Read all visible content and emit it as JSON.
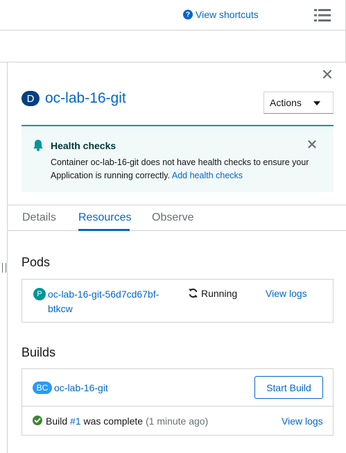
{
  "toolbar": {
    "shortcuts_label": "View shortcuts"
  },
  "drawer": {
    "resource_kind_badge": "D",
    "resource_name": "oc-lab-16-git",
    "actions_label": "Actions"
  },
  "alert": {
    "title": "Health checks",
    "message": "Container oc-lab-16-git does not have health checks to ensure your Application is running correctly.",
    "link": "Add health checks",
    "accent_color": "#009596"
  },
  "tabs": [
    {
      "label": "Details",
      "active": false
    },
    {
      "label": "Resources",
      "active": true
    },
    {
      "label": "Observe",
      "active": false
    }
  ],
  "pods": {
    "heading": "Pods",
    "badge": "P",
    "name": "oc-lab-16-git-56d7cd67bf-btkcw",
    "status": "Running",
    "logs_link": "View logs"
  },
  "builds": {
    "heading": "Builds",
    "badge": "BC",
    "config_name": "oc-lab-16-git",
    "start_button": "Start Build",
    "build_prefix": "Build",
    "build_number": "#1",
    "build_state": "was complete",
    "build_time": "(1 minute ago)",
    "logs_link": "View logs"
  },
  "colors": {
    "link": "#0066cc",
    "kind_badge_deployment": "#004080",
    "kind_badge_pod": "#009596",
    "kind_badge_buildconfig": "#2b9af3",
    "success": "#3e8635"
  }
}
